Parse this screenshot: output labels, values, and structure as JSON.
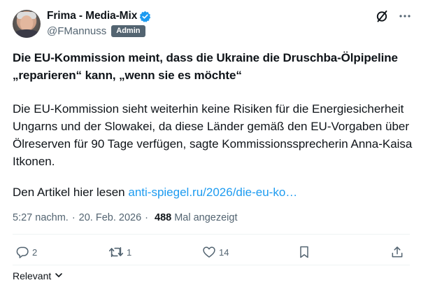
{
  "author": {
    "name": "Frima - Media-Mix",
    "handle": "@FMannuss",
    "badge": "Admin",
    "verified_color": "#1d9bf0"
  },
  "tweet": {
    "headline": "Die EU-Kommission meint, dass die Ukraine die Druschba-Ölpipeline „reparieren“ kann, „wenn sie es möchte“",
    "body": "Die EU-Kommission sieht weiterhin keine Risiken für die Energiesicherheit Ungarns und der Slowakei, da diese Länder gemäß den EU-Vorgaben über Ölreserven für 90 Tage verfügen, sagte Kommissionssprecherin Anna-Kaisa Itkonen.",
    "read_prefix": "Den Artikel hier lesen",
    "link": "anti-spiegel.ru/2026/die-eu-ko…",
    "link_color": "#1d9bf0"
  },
  "meta": {
    "time": "5:27 nachm.",
    "separator": "·",
    "date": "20. Feb. 2026",
    "views": "488",
    "views_label": "Mal angezeigt"
  },
  "actions": {
    "reply_count": "2",
    "repost_count": "1",
    "like_count": "14"
  },
  "sort": {
    "label": "Relevant"
  },
  "icons": {
    "grok": "grok-slash-circle-icon",
    "more": "more-dots-icon",
    "reply": "reply-bubble-icon",
    "repost": "repost-arrows-icon",
    "like": "heart-icon",
    "bookmark": "bookmark-icon",
    "share": "share-upload-icon",
    "chevron": "chevron-down-icon"
  }
}
